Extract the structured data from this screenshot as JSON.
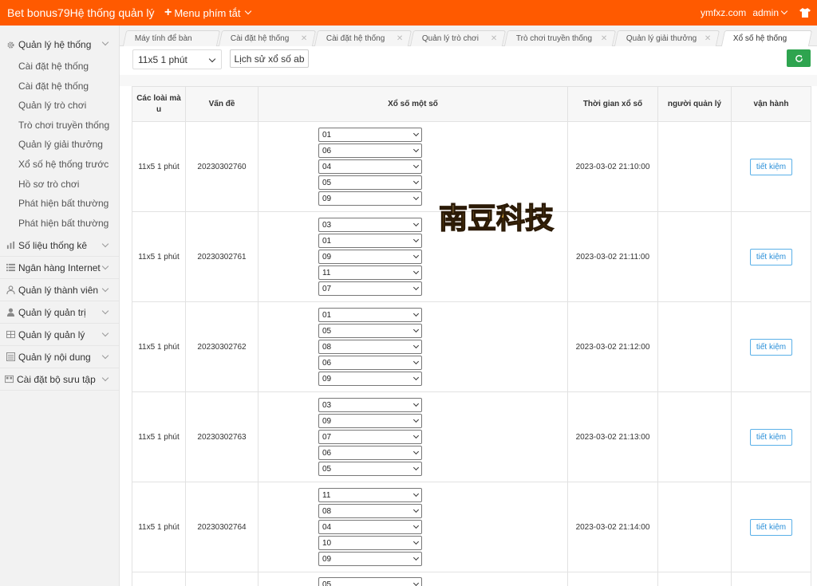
{
  "header": {
    "brand": "Bet bonus79Hệ thống quản lý",
    "quick_menu_label": "Menu phím tắt",
    "domain": "ymfxz.com",
    "user": "admin"
  },
  "sidebar": {
    "groups": [
      {
        "label": "Quản lý hệ thống",
        "icon": "gear-icon",
        "items": [
          "Cài đặt hệ thống",
          "Cài đặt hệ thống",
          "Quản lý trò chơi",
          "Trò chơi truyền thống",
          "Quản lý giải thưởng",
          "Xổ số hệ thống trước",
          "Hồ sơ trò chơi",
          "Phát hiện bất thường",
          "Phát hiện bất thường"
        ]
      },
      {
        "label": "Số liệu thống kê",
        "icon": "chart-icon"
      },
      {
        "label": "Ngân hàng Internet",
        "icon": "list-icon"
      },
      {
        "label": "Quản lý thành viên",
        "icon": "user-icon"
      },
      {
        "label": "Quản lý quản trị",
        "icon": "user-solid-icon"
      },
      {
        "label": "Quản lý quản lý",
        "icon": "grid-icon"
      },
      {
        "label": "Quản lý nội dung",
        "icon": "doc-icon"
      },
      {
        "label": "Cài đặt bộ sưu tập",
        "icon": "folder-icon"
      }
    ]
  },
  "tabs": [
    {
      "label": "Máy tính để bàn"
    },
    {
      "label": "Cài đặt hệ thống"
    },
    {
      "label": "Cài đặt hệ thống"
    },
    {
      "label": "Quản lý trò chơi"
    },
    {
      "label": "Trò chơi truyền thống"
    },
    {
      "label": "Quản lý giải thưởng"
    },
    {
      "label": "Xổ số hệ thống"
    }
  ],
  "toolbar": {
    "lottery_type": "11x5 1 phút",
    "history_button": "Lịch sử xổ số ab"
  },
  "table": {
    "headers": [
      "Các loài mà u",
      "Vấn đề",
      "Xổ số một số",
      "Thời gian xổ số",
      "người quản lý",
      "vận hành"
    ],
    "save_label": "tiết kiệm",
    "rows": [
      {
        "type": "11x5 1 phút",
        "issue": "20230302760",
        "balls": [
          "01",
          "06",
          "04",
          "05",
          "09"
        ],
        "time": "2023-03-02 21:10:00",
        "manager": ""
      },
      {
        "type": "11x5 1 phút",
        "issue": "20230302761",
        "balls": [
          "03",
          "01",
          "09",
          "11",
          "07"
        ],
        "time": "2023-03-02 21:11:00",
        "manager": ""
      },
      {
        "type": "11x5 1 phút",
        "issue": "20230302762",
        "balls": [
          "01",
          "05",
          "08",
          "06",
          "09"
        ],
        "time": "2023-03-02 21:12:00",
        "manager": ""
      },
      {
        "type": "11x5 1 phút",
        "issue": "20230302763",
        "balls": [
          "03",
          "09",
          "07",
          "06",
          "05"
        ],
        "time": "2023-03-02 21:13:00",
        "manager": ""
      },
      {
        "type": "11x5 1 phút",
        "issue": "20230302764",
        "balls": [
          "11",
          "08",
          "04",
          "10",
          "09"
        ],
        "time": "2023-03-02 21:14:00",
        "manager": ""
      }
    ],
    "partial_row": {
      "balls": [
        "05"
      ]
    }
  },
  "watermark": {
    "text": "南豆科技"
  }
}
